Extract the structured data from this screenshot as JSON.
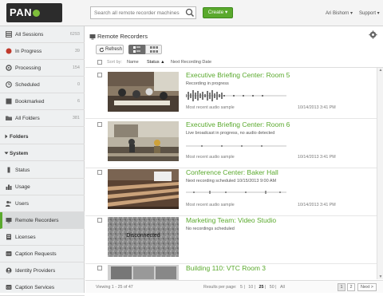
{
  "header": {
    "logo": "PANOPTO",
    "search_placeholder": "Search all remote recorder machines",
    "create_label": "Create ▾",
    "user_label": "Ari Bishorn ▾",
    "support_label": "Support ▾"
  },
  "sidebar": {
    "items": [
      {
        "label": "All Sessions",
        "count": "6293"
      },
      {
        "label": "In Progress",
        "count": "39"
      },
      {
        "label": "Processing",
        "count": "154"
      },
      {
        "label": "Scheduled",
        "count": "0"
      },
      {
        "label": "Bookmarked",
        "count": "6"
      },
      {
        "label": "All Folders",
        "count": "381"
      }
    ],
    "folders_label": "Folders",
    "system_label": "System",
    "system_items": [
      {
        "label": "Status"
      },
      {
        "label": "Usage"
      },
      {
        "label": "Users"
      },
      {
        "label": "Remote Recorders"
      },
      {
        "label": "Licenses"
      },
      {
        "label": "Caption Requests"
      },
      {
        "label": "Identity Providers"
      },
      {
        "label": "Caption Services"
      }
    ]
  },
  "main": {
    "title": "Remote Recorders",
    "refresh_label": "Refresh",
    "sort": {
      "prefix": "Sort by:",
      "name": "Name",
      "status": "Status ▲",
      "next": "Next Recording Date"
    },
    "recorders": [
      {
        "title": "Executive Briefing Center: Room 5",
        "status": "Recording in progress",
        "note": "Most recent audio sample",
        "time": "10/14/2013 3:41 PM"
      },
      {
        "title": "Executive Briefing Center: Room 6",
        "status": "Live broadcast in progress, no audio detected",
        "note": "Most recent audio sample",
        "time": "10/14/2013 3:41 PM"
      },
      {
        "title": "Conference Center: Baker Hall",
        "status": "Next recording scheduled 10/15/2013 9:00 AM",
        "note": "Most recent audio sample",
        "time": "10/14/2013 3:41 PM"
      },
      {
        "title": "Marketing Team: Video Studio",
        "status": "No recordings scheduled",
        "thumb_text": "Disconnected"
      },
      {
        "title": "Building 110: VTC Room 3",
        "status": "",
        "note": "",
        "time": ""
      }
    ],
    "footer": {
      "viewing": "Viewing 1 - 25 of 47",
      "per_page_label": "Results per page:",
      "per_page_options": [
        "5",
        "10",
        "25",
        "50",
        "All"
      ],
      "per_page_selected": "25",
      "pages": [
        "1",
        "2"
      ],
      "next_label": "Next >"
    }
  },
  "colors": {
    "accent": "#5aa92d",
    "sidebar_bg": "#eef0f1"
  }
}
